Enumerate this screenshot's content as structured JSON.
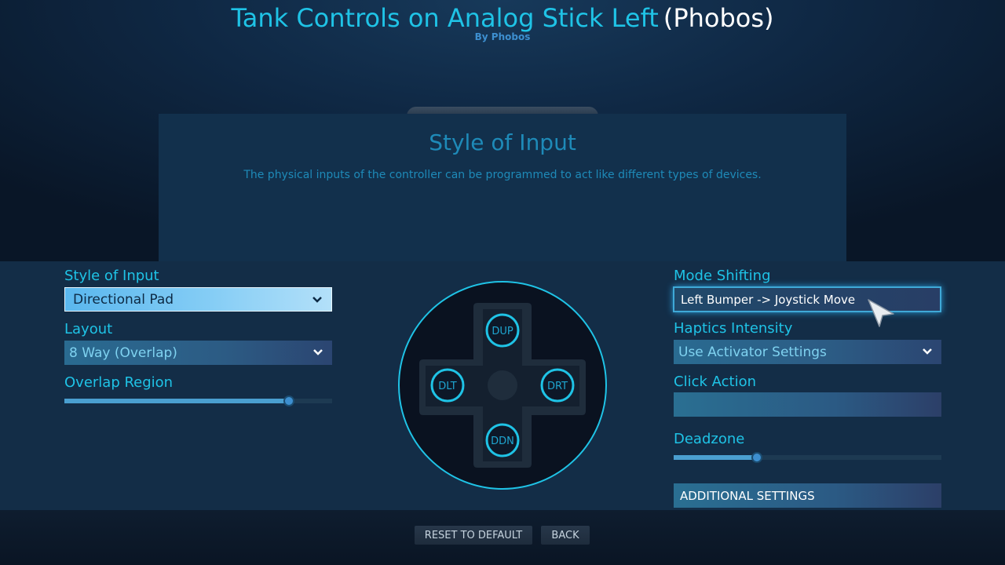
{
  "header": {
    "title": "Tank Controls on Analog Stick Left",
    "author_tag": "(Phobos)",
    "byline": "By Phobos"
  },
  "info": {
    "title": "Style of Input",
    "description": "The physical inputs of the controller can be programmed to act like different types of devices."
  },
  "left": {
    "style_label": "Style of Input",
    "style_value": "Directional Pad",
    "layout_label": "Layout",
    "layout_value": "8 Way (Overlap)",
    "overlap_label": "Overlap Region",
    "overlap_fraction": 0.84
  },
  "dpad": {
    "up": "DUP",
    "left": "DLT",
    "right": "DRT",
    "down": "DDN"
  },
  "right": {
    "mode_shift_label": "Mode Shifting",
    "mode_shift_value": "Left Bumper -> Joystick Move",
    "haptics_label": "Haptics Intensity",
    "haptics_value": "Use Activator Settings",
    "click_label": "Click Action",
    "deadzone_label": "Deadzone",
    "deadzone_fraction": 0.31,
    "additional_label": "ADDITIONAL SETTINGS"
  },
  "footer": {
    "reset_label": "RESET TO DEFAULT",
    "back_label": "BACK"
  },
  "colors": {
    "accent": "#1fc3e6",
    "panel": "#132d47",
    "selected": "#85cdf5"
  }
}
